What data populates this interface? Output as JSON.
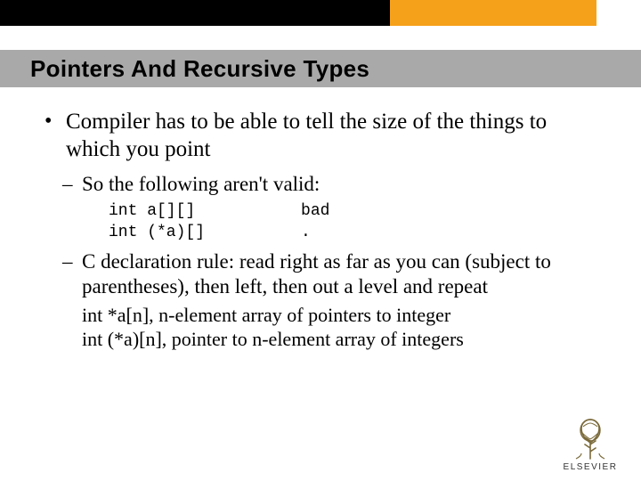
{
  "title": "Pointers And Recursive Types",
  "bullet1": "Compiler has to be able to tell the size of the things to which you point",
  "dash1": "So the following aren't valid:",
  "code_line1": "int a[][]           bad",
  "code_line2": "int (*a)[]          .",
  "dash2": "C declaration rule: read right as far as you can (subject to parentheses), then left, then out a level and repeat",
  "plain1": "int *a[n], n-element array of pointers to integer",
  "plain2": "int (*a)[n], pointer to n-element array of integers",
  "logo_text": "ELSEVIER"
}
